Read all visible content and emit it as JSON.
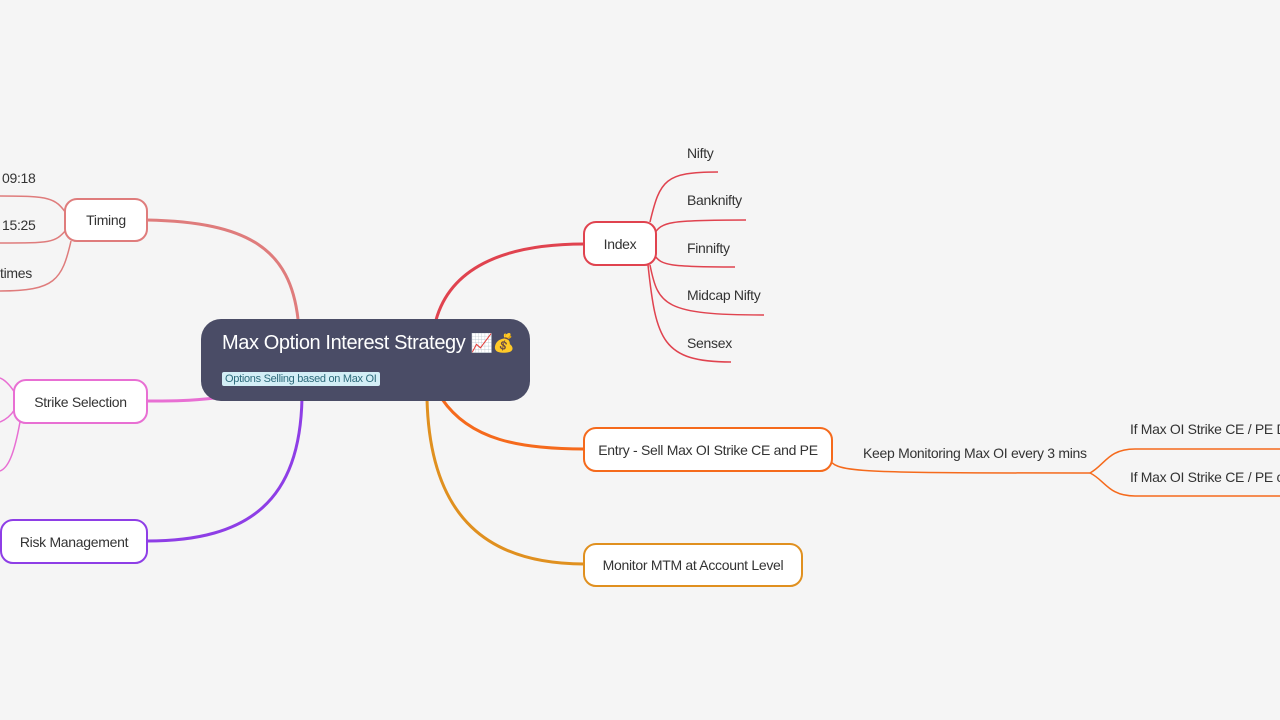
{
  "root": {
    "title": "Max Option Interest Strategy",
    "emoji_chart": "📈",
    "emoji_money": "💰",
    "label": "Options Selling based on Max OI"
  },
  "branches": {
    "timing": {
      "label": "Timing",
      "color": "#df7c7c",
      "children": [
        "09:18",
        "15:25",
        "times"
      ]
    },
    "strike_selection": {
      "label": "Strike Selection",
      "color": "#e86fd3"
    },
    "risk_management": {
      "label": "Risk Management",
      "color": "#8e3ee6"
    },
    "index": {
      "label": "Index",
      "color": "#e0434f",
      "children": [
        "Nifty",
        "Banknifty",
        "Finnifty",
        "Midcap Nifty",
        "Sensex"
      ]
    },
    "entry": {
      "label": "Entry - Sell Max OI Strike CE and PE",
      "color": "#f56a1c",
      "child": "Keep Monitoring Max OI every 3 mins",
      "grandchildren": [
        "If Max OI Strike CE / PE Do",
        "If Max OI Strike CE / PE ch"
      ]
    },
    "monitor": {
      "label": "Monitor MTM at Account Level",
      "color": "#e0901f"
    }
  }
}
